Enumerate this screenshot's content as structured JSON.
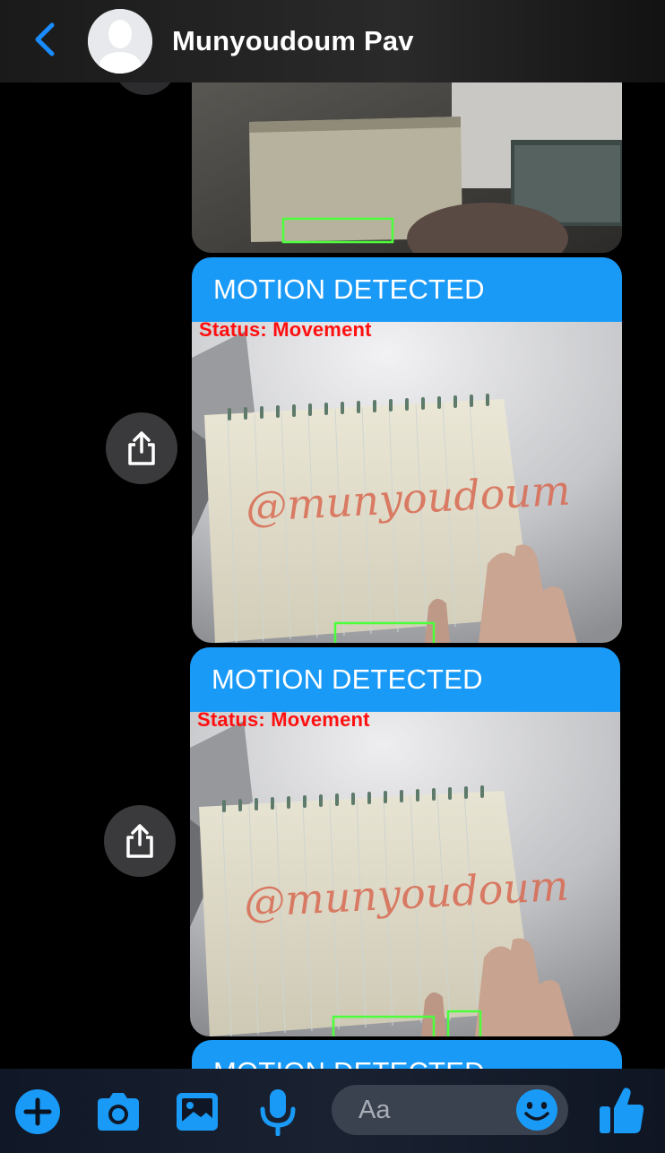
{
  "header": {
    "contact_name": "Munyoudoum Pav",
    "back_icon": "chevron-left-icon",
    "avatar_icon": "person-placeholder-icon"
  },
  "messages": [
    {
      "kind": "image-only-partial",
      "image_description": "camera frame with notebook and green motion box"
    },
    {
      "kind": "motion-alert",
      "title": "MOTION DETECTED",
      "overlay_status": "Status:  Movement",
      "handwriting": "@munyoudoum",
      "share_icon": "share-icon"
    },
    {
      "kind": "motion-alert",
      "title": "MOTION DETECTED",
      "overlay_status": "Status:  Movement",
      "handwriting": "@munyoudoum",
      "share_icon": "share-icon"
    },
    {
      "kind": "motion-alert-partial",
      "title": "MOTION DETECTED"
    }
  ],
  "toolbar": {
    "plus_icon": "plus-circle-icon",
    "camera_icon": "camera-icon",
    "gallery_icon": "image-icon",
    "mic_icon": "microphone-icon",
    "composer_placeholder": "Aa",
    "emoji_icon": "smiley-icon",
    "like_icon": "thumbs-up-icon"
  },
  "colors": {
    "accent": "#1a9af7",
    "overlay_text": "#ff1010",
    "motion_box": "#4cff3a",
    "background": "#000000"
  }
}
